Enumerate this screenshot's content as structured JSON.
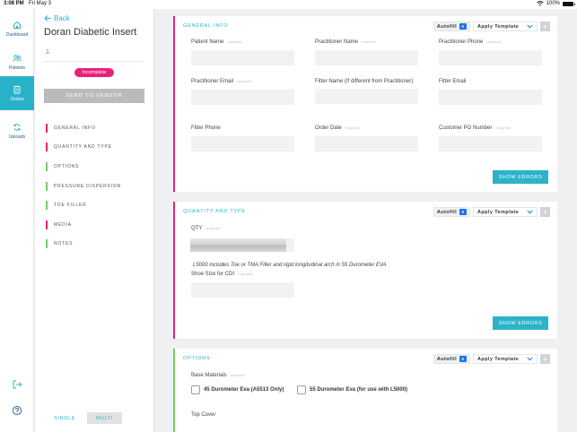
{
  "status_bar": {
    "time": "3:08 PM",
    "date": "Fri May 3",
    "battery": "100%"
  },
  "rail": {
    "dashboard": "Dashboard",
    "patients": "Patients",
    "orders": "Orders",
    "uploads": "Uploads"
  },
  "order": {
    "back_label": "Back",
    "title": "Doran Diabetic Insert",
    "status": "Incomplete",
    "send_label": "SEND TO VENDOR",
    "nav": [
      {
        "label": "GENERAL INFO",
        "state": "incomplete"
      },
      {
        "label": "QUANTITY AND TYPE",
        "state": "incomplete"
      },
      {
        "label": "OPTIONS",
        "state": "complete"
      },
      {
        "label": "PRESSURE DISPERSION",
        "state": "complete"
      },
      {
        "label": "TOE FILLER",
        "state": "complete"
      },
      {
        "label": "MEDIA",
        "state": "incomplete"
      },
      {
        "label": "NOTES",
        "state": "complete"
      }
    ],
    "mode_single": "SINGLE",
    "mode_multi": "MULTI",
    "mode_selected": "MULTI"
  },
  "colors": {
    "accent": "#2bb3c8",
    "incomplete": "#e9217a",
    "complete": "#6fcf62"
  },
  "controls": {
    "autofill": "Autofill",
    "autofill_count": "0",
    "apply_template": "Apply Template",
    "show_errors": "SHOW ERRORS"
  },
  "general_info": {
    "heading": "GENERAL INFO",
    "required_text": "required",
    "fields": {
      "patient_name": {
        "label": "Patient Name",
        "value": ""
      },
      "practitioner_name": {
        "label": "Practitioner Name",
        "value": ""
      },
      "practitioner_phone": {
        "label": "Practitioner Phone",
        "value": ""
      },
      "practitioner_email": {
        "label": "Practitioner Email",
        "value": ""
      },
      "fitter_name": {
        "label": "Fitter Name (If different from Practitioner)",
        "value": ""
      },
      "fitter_email": {
        "label": "Fitter Email",
        "value": ""
      },
      "fitter_phone": {
        "label": "Fitter Phone",
        "value": ""
      },
      "order_date": {
        "label": "Order Date",
        "value": ""
      },
      "customer_po": {
        "label": "Customer PO Number",
        "value": ""
      }
    }
  },
  "quantity_and_type": {
    "heading": "QUANTITY AND TYPE",
    "qty_label": "QTY",
    "qty_fill_fraction": 0.92,
    "note": "L5000 includes Toe or TMA Filler and rigid longitudinal arch in 55 Durometer EVA",
    "shoe_size_label": "Shoe Size for CDI",
    "shoe_size_value": ""
  },
  "options": {
    "heading": "OPTIONS",
    "base_materials_label": "Base Materials",
    "base_materials": [
      {
        "label": "45 Durometer Eva (A5513 Only)",
        "checked": false
      },
      {
        "label": "55 Durometer Eva (for use with L5000)",
        "checked": false
      }
    ],
    "top_cover_label": "Top Cover"
  }
}
